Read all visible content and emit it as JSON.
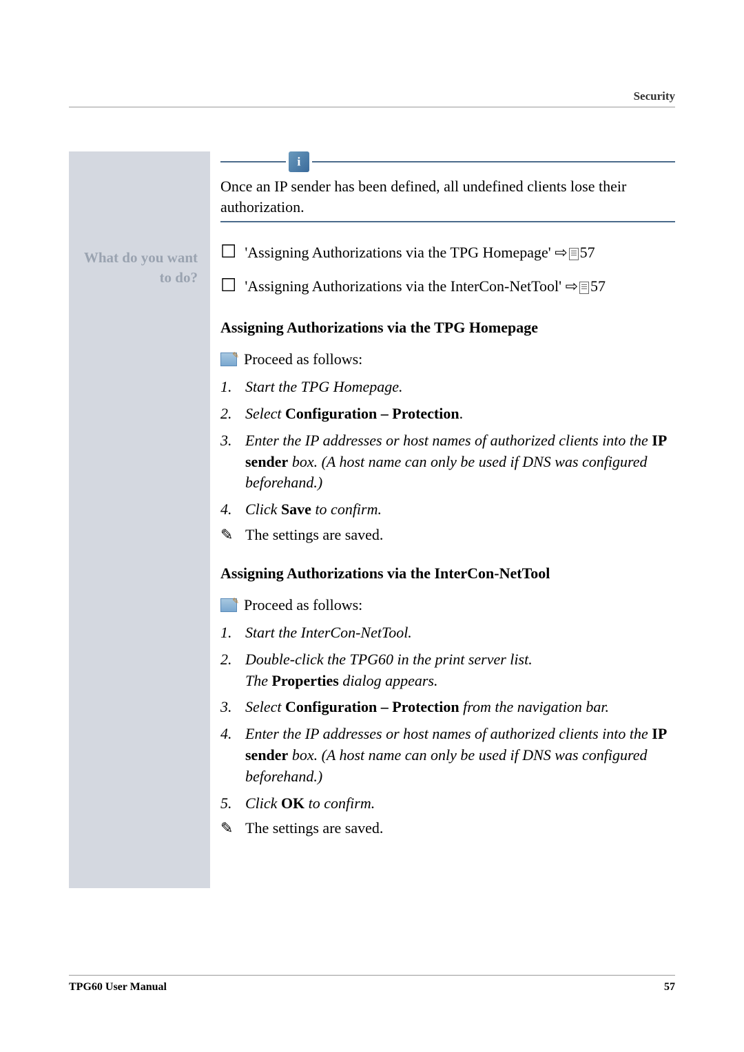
{
  "header": {
    "section": "Security"
  },
  "sidebar": {
    "label_line1": "What do you want",
    "label_line2": "to do?"
  },
  "callout": {
    "text": "Once an IP sender has been defined, all undefined clients lose their authorization."
  },
  "checkboxes": [
    {
      "prefix": "'Assigning Authorizations via the TPG Homepage' ",
      "arrow": "⇨",
      "page": "57"
    },
    {
      "prefix": "'Assigning Authorizations via the InterCon-NetTool' ",
      "arrow": "⇨",
      "page": "57"
    }
  ],
  "section1": {
    "heading": "Assigning Authorizations via the TPG Homepage",
    "proceed": "Proceed as follows:",
    "steps": [
      {
        "num": "1.",
        "italic_before": "Start the TPG Homepage.",
        "bold": "",
        "italic_after": ""
      },
      {
        "num": "2.",
        "italic_before": "Select ",
        "bold": "Configuration – Protection",
        "italic_after": "."
      },
      {
        "num": "3.",
        "italic_before": "Enter the IP addresses or host names of authorized clients into the ",
        "bold": "IP sender",
        "italic_after": " box. (A host name can only be used if DNS was configured beforehand.)"
      },
      {
        "num": "4.",
        "italic_before": "Click ",
        "bold": "Save",
        "italic_after": " to confirm."
      }
    ],
    "result": "The settings are saved."
  },
  "section2": {
    "heading": "Assigning Authorizations via the InterCon-NetTool",
    "proceed": "Proceed as follows:",
    "steps": [
      {
        "num": "1.",
        "italic_before": "Start the InterCon-NetTool.",
        "bold": "",
        "italic_after": ""
      },
      {
        "num": "2.",
        "italic_before": "Double-click the TPG60 in the print server list.",
        "bold": "",
        "italic_after": "",
        "line2_before": "The ",
        "line2_bold": "Properties",
        "line2_after": " dialog appears."
      },
      {
        "num": "3.",
        "italic_before": "Select ",
        "bold": "Configuration – Protection",
        "italic_after": " from the navigation bar."
      },
      {
        "num": "4.",
        "italic_before": "Enter the IP addresses or host names of authorized clients into the ",
        "bold": "IP sender",
        "italic_after": " box. (A host name can only be used if DNS was configured beforehand.)"
      },
      {
        "num": "5.",
        "italic_before": "Click ",
        "bold": "OK",
        "italic_after": " to confirm."
      }
    ],
    "result": "The settings are saved."
  },
  "footer": {
    "manual": "TPG60 User Manual",
    "page": "57"
  }
}
